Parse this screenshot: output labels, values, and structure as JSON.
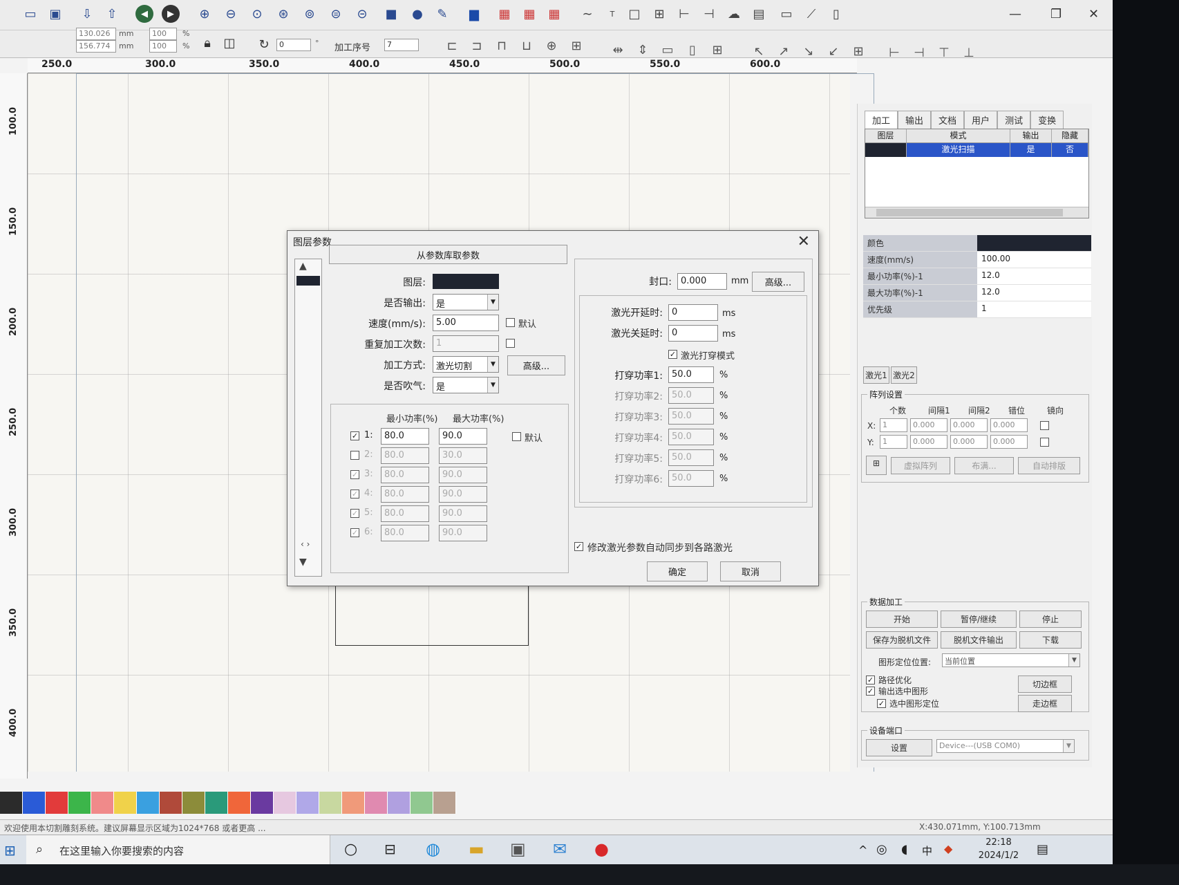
{
  "toolbar": {
    "size_w": "130.026",
    "size_h": "156.774",
    "unit": "mm",
    "pos_x": "",
    "pos_y": "",
    "scale_w": "100",
    "scale_h": "100",
    "percent": "%",
    "rotate": "0",
    "deg": "°",
    "seq_label": "加工序号",
    "seq_value": "7"
  },
  "ruler": {
    "h": [
      "250.0",
      "300.0",
      "350.0",
      "400.0",
      "450.0",
      "500.0",
      "550.0",
      "600.0"
    ],
    "v": [
      "100.0",
      "150.0",
      "200.0",
      "250.0",
      "300.0",
      "350.0",
      "400.0"
    ]
  },
  "right_panel": {
    "tabs": [
      "加工",
      "输出",
      "文档",
      "用户",
      "测试",
      "变换"
    ],
    "table_head": [
      "图层",
      "模式",
      "输出",
      "隐藏"
    ],
    "table_row": {
      "color": "#1f2430",
      "mode": "激光扫描",
      "output": "是",
      "hidden": "否"
    },
    "props": [
      {
        "k": "颜色",
        "v": ""
      },
      {
        "k": "速度(mm/s)",
        "v": "100.00"
      },
      {
        "k": "最小功率(%)-1",
        "v": "12.0"
      },
      {
        "k": "最大功率(%)-1",
        "v": "12.0"
      },
      {
        "k": "优先级",
        "v": "1"
      }
    ],
    "laser_tabs": [
      "激光1",
      "激光2"
    ],
    "array_title": "阵列设置",
    "array_head": [
      "个数",
      "间隔1",
      "间隔2",
      "错位",
      "镜向"
    ],
    "array_x": {
      "label": "X:",
      "count": "1",
      "g1": "0.000",
      "g2": "0.000",
      "off": "0.000"
    },
    "array_y": {
      "label": "Y:",
      "count": "1",
      "g1": "0.000",
      "g2": "0.000",
      "off": "0.000"
    },
    "array_btns": [
      "虚拟阵列",
      "布满...",
      "自动排版"
    ],
    "proc_title": "数据加工",
    "proc_btns": [
      "开始",
      "暂停/继续",
      "停止",
      "保存为脱机文件",
      "脱机文件输出",
      "下载"
    ],
    "pos_label": "图形定位位置:",
    "pos_value": "当前位置",
    "checks": [
      "路径优化",
      "输出选中图形",
      "选中图形定位"
    ],
    "side_btns": [
      "切边框",
      "走边框"
    ],
    "port_title": "设备端口",
    "port_btn": "设置",
    "port_value": "Device---(USB COM0)"
  },
  "dialog": {
    "title": "图层参数",
    "from_db": "从参数库取参数",
    "layer_label": "图层:",
    "layer_color": "#1f2430",
    "output_label": "是否输出:",
    "output_value": "是",
    "speed_label": "速度(mm/s):",
    "speed_value": "5.00",
    "default": "默认",
    "repeat_label": "重复加工次数:",
    "repeat_value": "1",
    "mode_label": "加工方式:",
    "mode_value": "激光切割",
    "advanced": "高级...",
    "blow_label": "是否吹气:",
    "blow_value": "是",
    "min_power_head": "最小功率(%)",
    "max_power_head": "最大功率(%)",
    "power_rows": [
      {
        "n": "1:",
        "min": "80.0",
        "max": "90.0"
      },
      {
        "n": "2:",
        "min": "80.0",
        "max": "30.0"
      },
      {
        "n": "3:",
        "min": "80.0",
        "max": "90.0"
      },
      {
        "n": "4:",
        "min": "80.0",
        "max": "90.0"
      },
      {
        "n": "5:",
        "min": "80.0",
        "max": "90.0"
      },
      {
        "n": "6:",
        "min": "80.0",
        "max": "90.0"
      }
    ],
    "seal_label": "封口:",
    "seal_value": "0.000",
    "mm": "mm",
    "on_delay_label": "激光开延时:",
    "on_delay_value": "0",
    "off_delay_label": "激光关延时:",
    "off_delay_value": "0",
    "ms": "ms",
    "dot_mode_label": "激光打穿模式",
    "dot_powers": [
      {
        "label": "打穿功率1:",
        "v": "50.0"
      },
      {
        "label": "打穿功率2:",
        "v": "50.0"
      },
      {
        "label": "打穿功率3:",
        "v": "50.0"
      },
      {
        "label": "打穿功率4:",
        "v": "50.0"
      },
      {
        "label": "打穿功率5:",
        "v": "50.0"
      },
      {
        "label": "打穿功率6:",
        "v": "50.0"
      }
    ],
    "sync_label": "修改激光参数自动同步到各路激光",
    "ok": "确定",
    "cancel": "取消"
  },
  "palette": [
    "#2b2b2b",
    "#2a5bd7",
    "#e23b3b",
    "#3cb54a",
    "#f08a8a",
    "#f0d24a",
    "#3aa0e0",
    "#b04a3a",
    "#8c8c3a",
    "#2a9a7a",
    "#f0663a",
    "#6a3aa0",
    "#e6c8e0",
    "#b0a8e8",
    "#c8d8a0",
    "#f09a7a",
    "#e08ab0",
    "#b0a0e0",
    "#90c890",
    "#b8a090"
  ],
  "status": {
    "left": "欢迎使用本切割雕刻系统。建议屏幕显示区域为1024*768 或者更高 ...",
    "coords": "X:430.071mm, Y:100.713mm"
  },
  "taskbar": {
    "search": "在这里输入你要搜索的内容",
    "time": "22:18",
    "date": "2024/1/2",
    "ime": "中"
  }
}
